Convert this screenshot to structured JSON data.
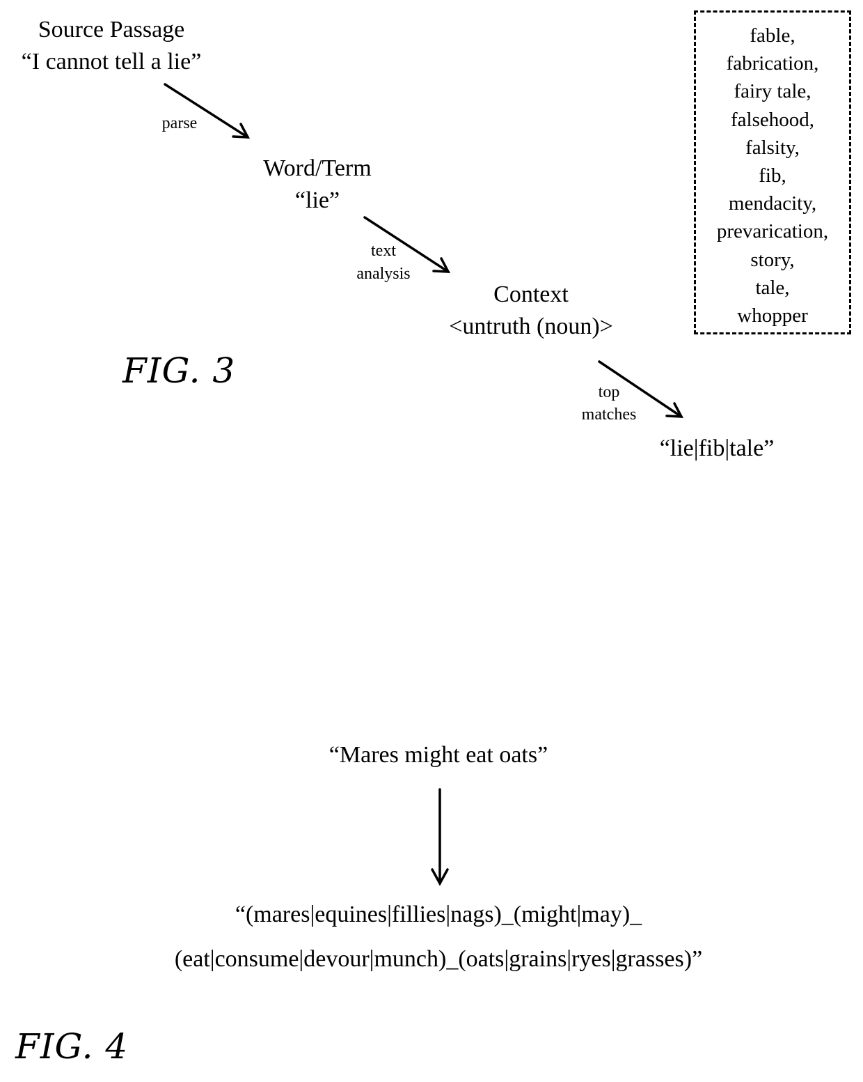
{
  "fig3": {
    "source": {
      "label": "Source Passage",
      "value": "“I cannot tell a lie”"
    },
    "word": {
      "label": "Word/Term",
      "value": "“lie”"
    },
    "context": {
      "label": "Context",
      "value": "<untruth (noun)>"
    },
    "result": "“lie|fib|tale”",
    "arrows": [
      {
        "label": "parse"
      },
      {
        "label_line1": "text",
        "label_line2": "analysis"
      },
      {
        "label_line1": "top",
        "label_line2": "matches"
      }
    ],
    "synonyms": [
      "fable,",
      "fabrication,",
      "fairy tale,",
      "falsehood,",
      "falsity,",
      "fib,",
      "mendacity,",
      "prevarication,",
      "story,",
      "tale,",
      "whopper"
    ],
    "caption": "FIG. 3"
  },
  "fig4": {
    "input": "“Mares might eat oats”",
    "output_line1": "“(mares|equines|fillies|nags)_(might|may)_",
    "output_line2": "(eat|consume|devour|munch)_(oats|grains|ryes|grasses)”",
    "caption": "FIG. 4"
  }
}
